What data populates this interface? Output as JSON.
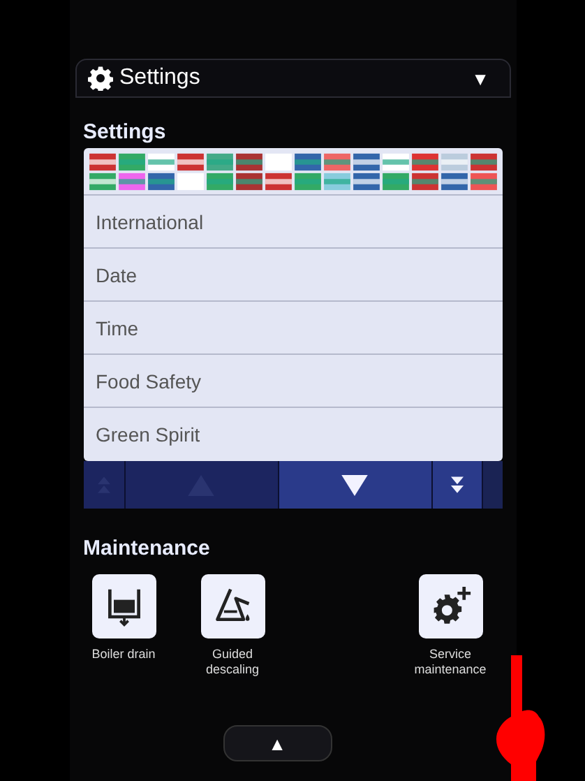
{
  "header": {
    "title": "Settings",
    "caret": "▼"
  },
  "settings": {
    "heading": "Settings",
    "items": [
      {
        "label": "International"
      },
      {
        "label": "Date"
      },
      {
        "label": "Time"
      },
      {
        "label": "Food Safety"
      },
      {
        "label": "Green Spirit"
      }
    ],
    "nav": [
      {
        "kind": "first",
        "disabled": true
      },
      {
        "kind": "up",
        "disabled": true
      },
      {
        "kind": "down",
        "disabled": false
      },
      {
        "kind": "last",
        "disabled": false
      }
    ]
  },
  "maintenance": {
    "heading": "Maintenance",
    "tiles": [
      {
        "kind": "drain",
        "label": "Boiler drain"
      },
      {
        "kind": "descale",
        "label": "Guided descaling"
      },
      {
        "kind": "gap"
      },
      {
        "kind": "service",
        "label": "Service maintenance"
      }
    ]
  },
  "bottom_tab": {
    "symbol": "▲"
  }
}
